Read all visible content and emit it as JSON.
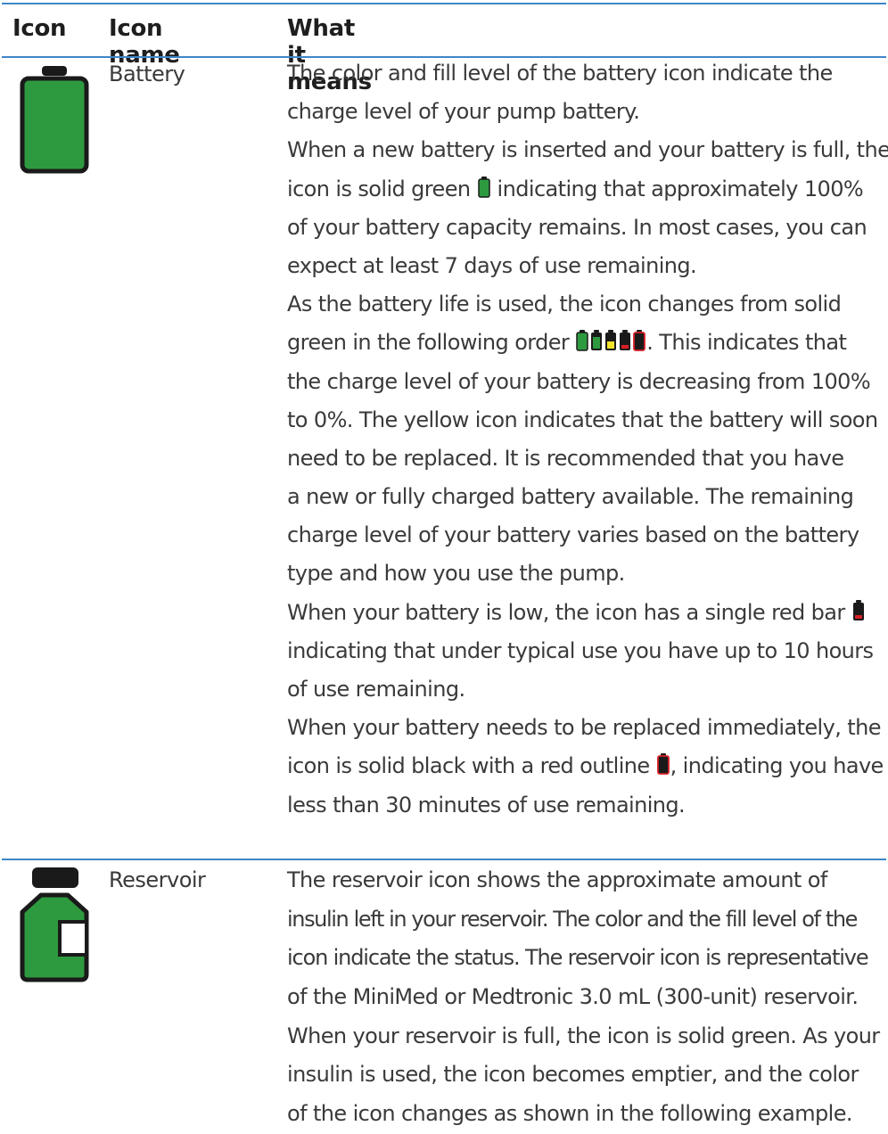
{
  "header": {
    "col_icon": "Icon",
    "col_name": "Icon name",
    "col_meaning": "What it means"
  },
  "rows": [
    {
      "name": "Battery",
      "icon": "battery-full-icon",
      "lines": [
        "The color and fill level of the battery icon indicate the",
        "charge level of your pump battery.",
        "When a new battery is inserted and your battery is full, the",
        [
          "icon is solid green ",
          " indicating that approximately 100%"
        ],
        "of your battery capacity remains. In most cases, you can",
        "expect at least 7 days of use remaining.",
        "As the battery life is used, the icon changes from solid",
        [
          "green in the following order ",
          ". This indicates that"
        ],
        "the charge level of your battery is decreasing from 100%",
        "to 0%. The yellow icon indicates that the battery will soon",
        "need to be replaced. It is recommended that you have",
        "a new or fully charged battery available. The remaining",
        "charge level of your battery varies based on the battery",
        "type and how you use the pump.",
        [
          "When your battery is low, the icon has a single red bar ",
          ""
        ],
        "indicating that under typical use you have up to 10 hours",
        "of use remaining.",
        "When your battery needs to be replaced immediately, the",
        [
          "icon is solid black with a red outline ",
          ", indicating you have"
        ],
        "less than 30 minutes of use remaining."
      ]
    },
    {
      "name": "Reservoir",
      "icon": "reservoir-full-icon",
      "lines": [
        "The reservoir icon shows the approximate amount of",
        "insulin left in your reservoir. The color and the fill level of the",
        "icon indicate the status. The reservoir icon is representative",
        "of the MiniMed or Medtronic 3.0 mL (300-unit) reservoir.",
        "When your reservoir is full, the icon is solid green. As your",
        "insulin is used, the icon becomes emptier, and the color",
        "of the icon changes as shown in the following example."
      ]
    }
  ],
  "colors": {
    "rule": "#3f86c8",
    "battery_green": "#2e9a3f",
    "battery_yellow": "#f2e22a",
    "battery_red": "#d71f26",
    "icon_outline": "#1a1a1a"
  }
}
